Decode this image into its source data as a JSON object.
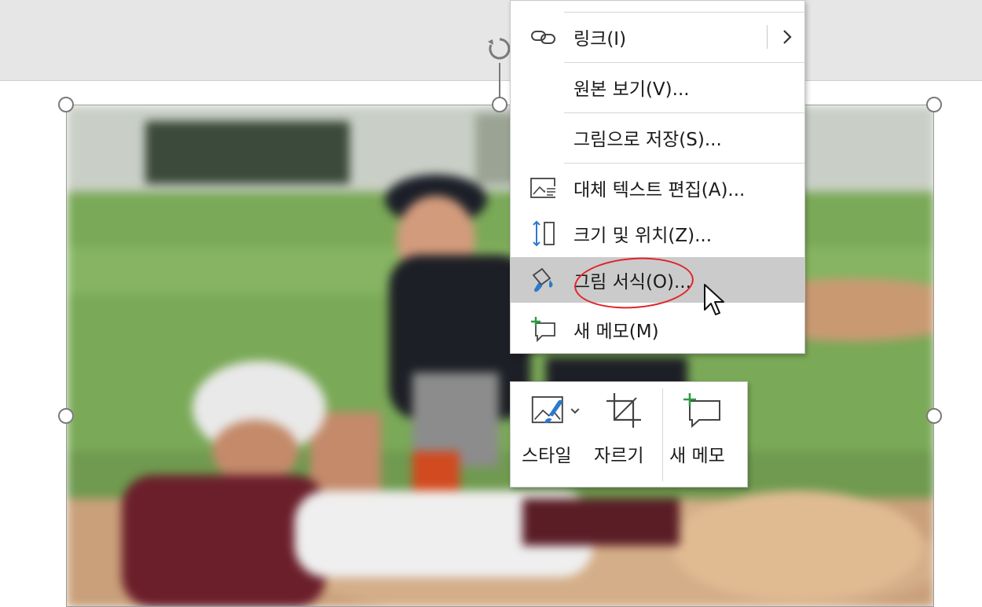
{
  "context_menu": {
    "items": [
      {
        "label": "링크(I)",
        "icon": "link-icon",
        "has_submenu": true
      },
      {
        "label": "원본 보기(V)...",
        "icon": ""
      },
      {
        "label": "그림으로 저장(S)...",
        "icon": ""
      },
      {
        "label": "대체 텍스트 편집(A)...",
        "icon": "alt-text-icon"
      },
      {
        "label": "크기 및 위치(Z)...",
        "icon": "size-position-icon"
      },
      {
        "label": "그림 서식(O)...",
        "icon": "format-picture-icon",
        "highlighted": true
      },
      {
        "label": "새 메모(M)",
        "icon": "new-comment-icon"
      }
    ]
  },
  "mini_toolbar": {
    "style_label": "스타일",
    "crop_label": "자르기",
    "comment_label": "새 메모"
  },
  "colors": {
    "highlight": "#cbcbcb",
    "annotation_oval": "#e0242a",
    "accent_blue": "#2b79d0",
    "accent_green": "#2e9a47"
  }
}
